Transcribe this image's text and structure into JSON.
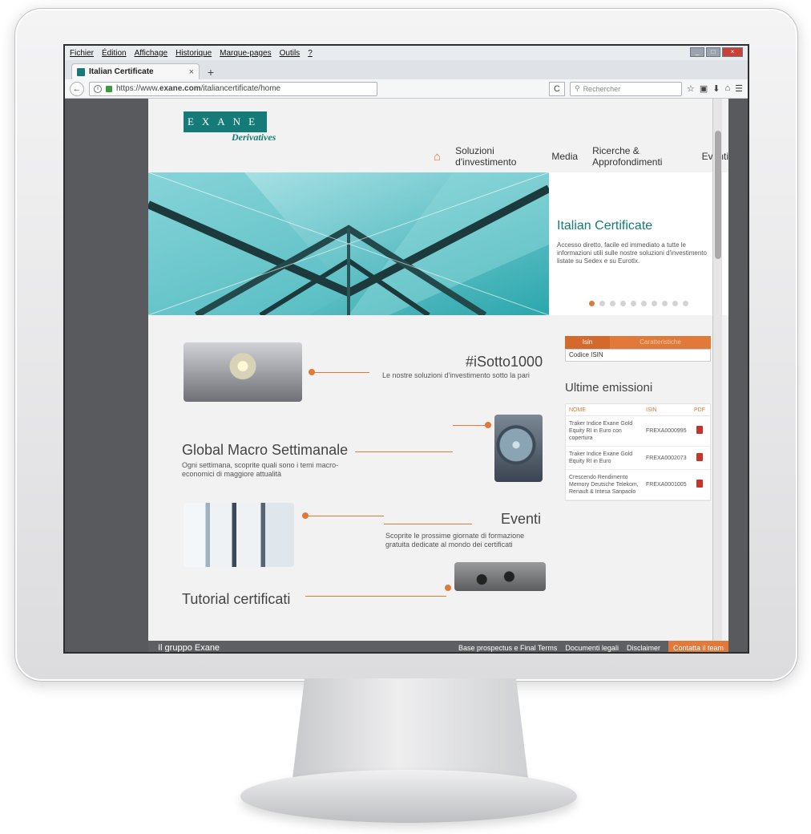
{
  "browser": {
    "menu": [
      "Fichier",
      "Édition",
      "Affichage",
      "Historique",
      "Marque-pages",
      "Outils",
      "?"
    ],
    "tab_title": "Italian Certificate",
    "tab_close": "×",
    "new_tab": "+",
    "url_prefix": "https://www.",
    "url_domain": "exane.com",
    "url_path": "/italiancertificate/home",
    "search_placeholder": "Rechercher",
    "reload": "C",
    "toolbar_icons": [
      "☆",
      "▣",
      "⬇",
      "⌂",
      "☰"
    ]
  },
  "site": {
    "logo_text": "EXANE",
    "logo_sub": "Derivatives",
    "nav": [
      "Soluzioni d'investimento",
      "Media",
      "Ricerche & Approfondimenti",
      "Eventi"
    ]
  },
  "hero": {
    "title": "Italian Certificate",
    "text": "Accesso diretto, facile ed immediato a tutte le informazioni utili sulle nostre soluzioni d'investimento listate su Sedex e su Eurotlx.",
    "slides": 10,
    "active_slide": 0
  },
  "blocks": {
    "sotto_title": "#iSotto1000",
    "sotto_text": "Le nostre soluzioni d'investimento sotto la pari",
    "macro_title": "Global Macro Settimanale",
    "macro_text": "Ogni settimana, scoprite quali sono i temi macro-economici di maggiore attualità",
    "eventi_title": "Eventi",
    "eventi_text": "Scoprite le prossime giornate di formazione gratuita dedicate al mondo dei certificati",
    "tutorial_title": "Tutorial certificati"
  },
  "isin": {
    "tab1": "Isin",
    "tab2": "Caratteristiche",
    "placeholder": "Codice ISIN"
  },
  "emissioni": {
    "title": "Ultime emissioni",
    "headers": [
      "NOME",
      "ISIN",
      "PDF"
    ],
    "rows": [
      {
        "nome": "Traker Indice Exane Gold Equity RI in Euro con copertura",
        "isin": "FREXA0000995"
      },
      {
        "nome": "Traker Indice Exane Gold Equity RI in Euro",
        "isin": "FREXA0002073"
      },
      {
        "nome": "Crescendo Rendimento Memory Deutsche Telekom, Renault & Intesa Sanpaolo",
        "isin": "FREXA0001005"
      }
    ]
  },
  "footer": {
    "left": "Il gruppo Exane",
    "links": [
      "Base prospectus e Final Terms",
      "Documenti legali",
      "Disclaimer"
    ],
    "contact": "Contatta il team"
  },
  "colors": {
    "brand": "#147b78",
    "accent": "#e0793a"
  }
}
